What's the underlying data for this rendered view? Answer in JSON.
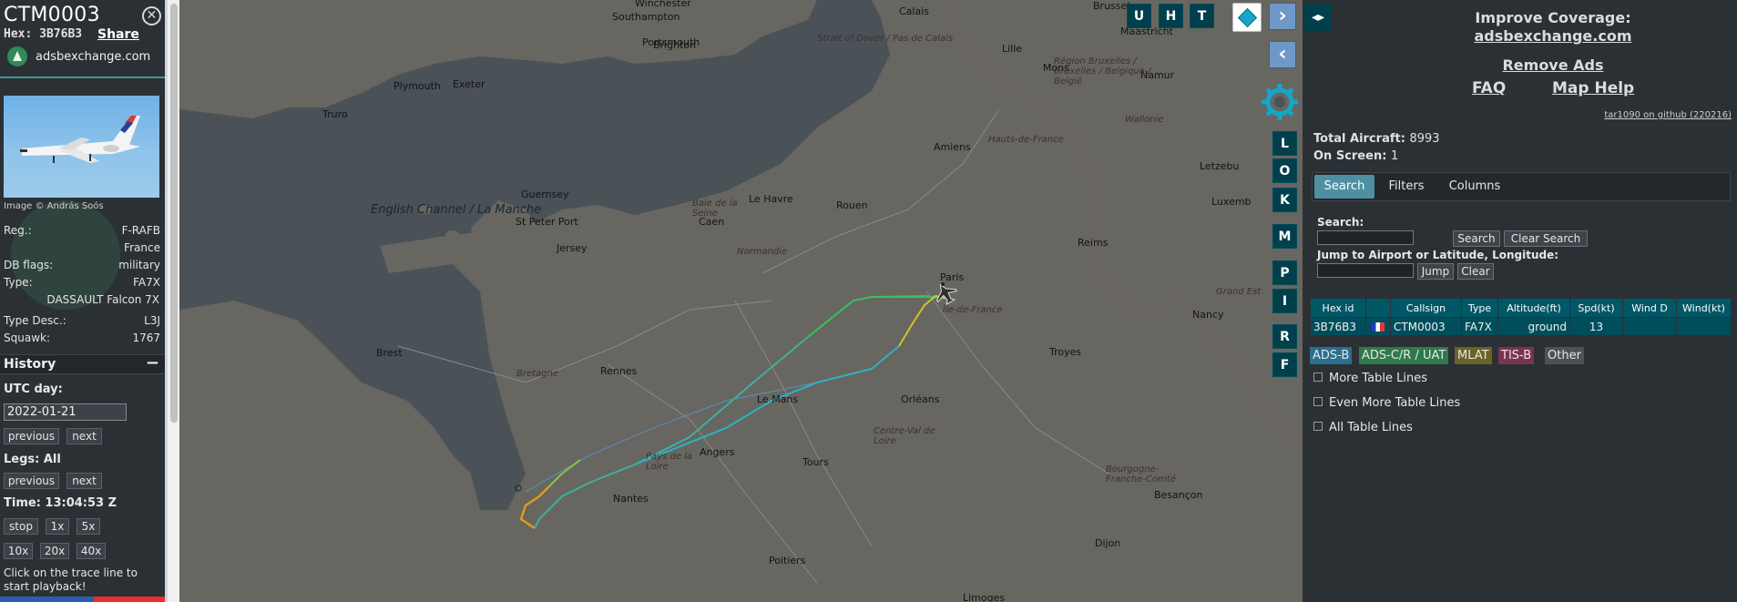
{
  "aircraft": {
    "callsign": "CTM0003",
    "hex_label": "Hex:",
    "hex": "3B76B3",
    "share": "Share",
    "site": "adsbexchange.com",
    "photo_credit": "Image © András Soós",
    "details": [
      {
        "key": "Reg.:",
        "value": "F-RAFB"
      },
      {
        "key": "",
        "value": "France"
      },
      {
        "key": "DB flags:",
        "value": "military"
      },
      {
        "key": "Type:",
        "value": "FA7X"
      },
      {
        "key": "",
        "value": "DASSAULT Falcon 7X"
      },
      {
        "key": "Type Desc.:",
        "value": "L3J"
      },
      {
        "key": "Squawk:",
        "value": "1767"
      }
    ]
  },
  "history": {
    "title": "History",
    "collapse": "−",
    "utc_day_label": "UTC day:",
    "date": "2022-01-21",
    "previous": "previous",
    "next": "next",
    "legs_label": "Legs: All",
    "time_label": "Time: 13:04:53 Z",
    "playback": [
      "stop",
      "1x",
      "5x",
      "10x",
      "20x",
      "40x"
    ],
    "help": "Click on the trace line to start playback!"
  },
  "map": {
    "buttons_top": [
      "U",
      "H",
      "T"
    ],
    "side_buttons": [
      "L",
      "O",
      "K",
      "M",
      "P",
      "I",
      "R",
      "F"
    ],
    "nav_right": "›",
    "nav_left": "‹",
    "places": [
      {
        "name": "Winchester",
        "cls": "place"
      },
      {
        "name": "Brighton",
        "cls": "place"
      },
      {
        "name": "Southampton",
        "cls": "place"
      },
      {
        "name": "Portsmouth",
        "cls": "place"
      },
      {
        "name": "Exeter",
        "cls": "place"
      },
      {
        "name": "Plymouth",
        "cls": "place"
      },
      {
        "name": "Truro",
        "cls": "place"
      },
      {
        "name": "Calais",
        "cls": "place"
      },
      {
        "name": "Brussel",
        "cls": "place"
      },
      {
        "name": "Lille",
        "cls": "place"
      },
      {
        "name": "Mons",
        "cls": "place"
      },
      {
        "name": "Namur",
        "cls": "place"
      },
      {
        "name": "Maastricht",
        "cls": "place"
      },
      {
        "name": "Amiens",
        "cls": "place"
      },
      {
        "name": "Le Havre",
        "cls": "place"
      },
      {
        "name": "Rouen",
        "cls": "place"
      },
      {
        "name": "Caen",
        "cls": "place"
      },
      {
        "name": "Reims",
        "cls": "place"
      },
      {
        "name": "Paris",
        "cls": "place"
      },
      {
        "name": "Guernsey",
        "cls": "place"
      },
      {
        "name": "St Peter Port",
        "cls": "place"
      },
      {
        "name": "Jersey",
        "cls": "place"
      },
      {
        "name": "Brest",
        "cls": "place"
      },
      {
        "name": "Rennes",
        "cls": "place"
      },
      {
        "name": "Le Mans",
        "cls": "place"
      },
      {
        "name": "Orléans",
        "cls": "place"
      },
      {
        "name": "Angers",
        "cls": "place"
      },
      {
        "name": "Nantes",
        "cls": "place"
      },
      {
        "name": "Tours",
        "cls": "place"
      },
      {
        "name": "Troyes",
        "cls": "place"
      },
      {
        "name": "Nancy",
        "cls": "place"
      },
      {
        "name": "Poitiers",
        "cls": "place"
      },
      {
        "name": "Limoges",
        "cls": "place"
      },
      {
        "name": "Dijon",
        "cls": "place"
      },
      {
        "name": "Besançon",
        "cls": "place"
      },
      {
        "name": "Letzebu",
        "cls": "place"
      },
      {
        "name": "Luxemb",
        "cls": "place"
      }
    ],
    "regions": [
      {
        "name": "English Channel / La Manche"
      },
      {
        "name": "Strait of Dover / Pas de Calais"
      },
      {
        "name": "Hauts-de-France"
      },
      {
        "name": "Normandie"
      },
      {
        "name": "Île-de-France"
      },
      {
        "name": "Bretagne"
      },
      {
        "name": "Pays de la Loire"
      },
      {
        "name": "Centre-Val de Loire"
      },
      {
        "name": "Grand Est"
      },
      {
        "name": "Bourgogne-Franche-Comté"
      },
      {
        "name": "Région Bruxelles / Bruxelles / Belgique / België"
      },
      {
        "name": "Wallonie"
      },
      {
        "name": "Baie de la Seine"
      }
    ]
  },
  "right": {
    "improve": "Improve Coverage:",
    "improve_link": "adsbexchange.com",
    "remove_ads": "Remove Ads",
    "faq": "FAQ",
    "map_help": "Map Help",
    "version": "tar1090 on github (220216)",
    "total_label": "Total Aircraft:",
    "total": "8993",
    "onscreen_label": "On Screen:",
    "onscreen": "1",
    "tabs": [
      "Search",
      "Filters",
      "Columns"
    ],
    "search_label": "Search:",
    "search_btn": "Search",
    "clear_search_btn": "Clear Search",
    "jump_label": "Jump to Airport or Latitude, Longitude:",
    "jump_btn": "Jump",
    "clear_btn": "Clear",
    "table": {
      "headers": [
        "Hex id",
        "",
        "Callsign",
        "Type",
        "Altitude(ft)",
        "Spd(kt)",
        "Wind D",
        "Wind(kt)"
      ],
      "row": {
        "hex": "3B76B3",
        "callsign": "CTM0003",
        "type": "FA7X",
        "altitude": "ground",
        "speed": "13",
        "wind_d": "",
        "wind_kt": ""
      }
    },
    "legend": [
      {
        "label": "ADS-B",
        "color": "#2a6f8f"
      },
      {
        "label": "ADS-C/R / UAT",
        "color": "#2f7a4a"
      },
      {
        "label": "MLAT",
        "color": "#6b6228"
      },
      {
        "label": "TIS-B",
        "color": "#7a3352"
      },
      {
        "label": "Other",
        "color": "#4c5257"
      }
    ],
    "options": [
      "More Table Lines",
      "Even More Table Lines",
      "All Table Lines"
    ]
  },
  "colors": {
    "panel": "#2b3035",
    "button": "#003f4b",
    "accent": "#4f8fa2"
  }
}
